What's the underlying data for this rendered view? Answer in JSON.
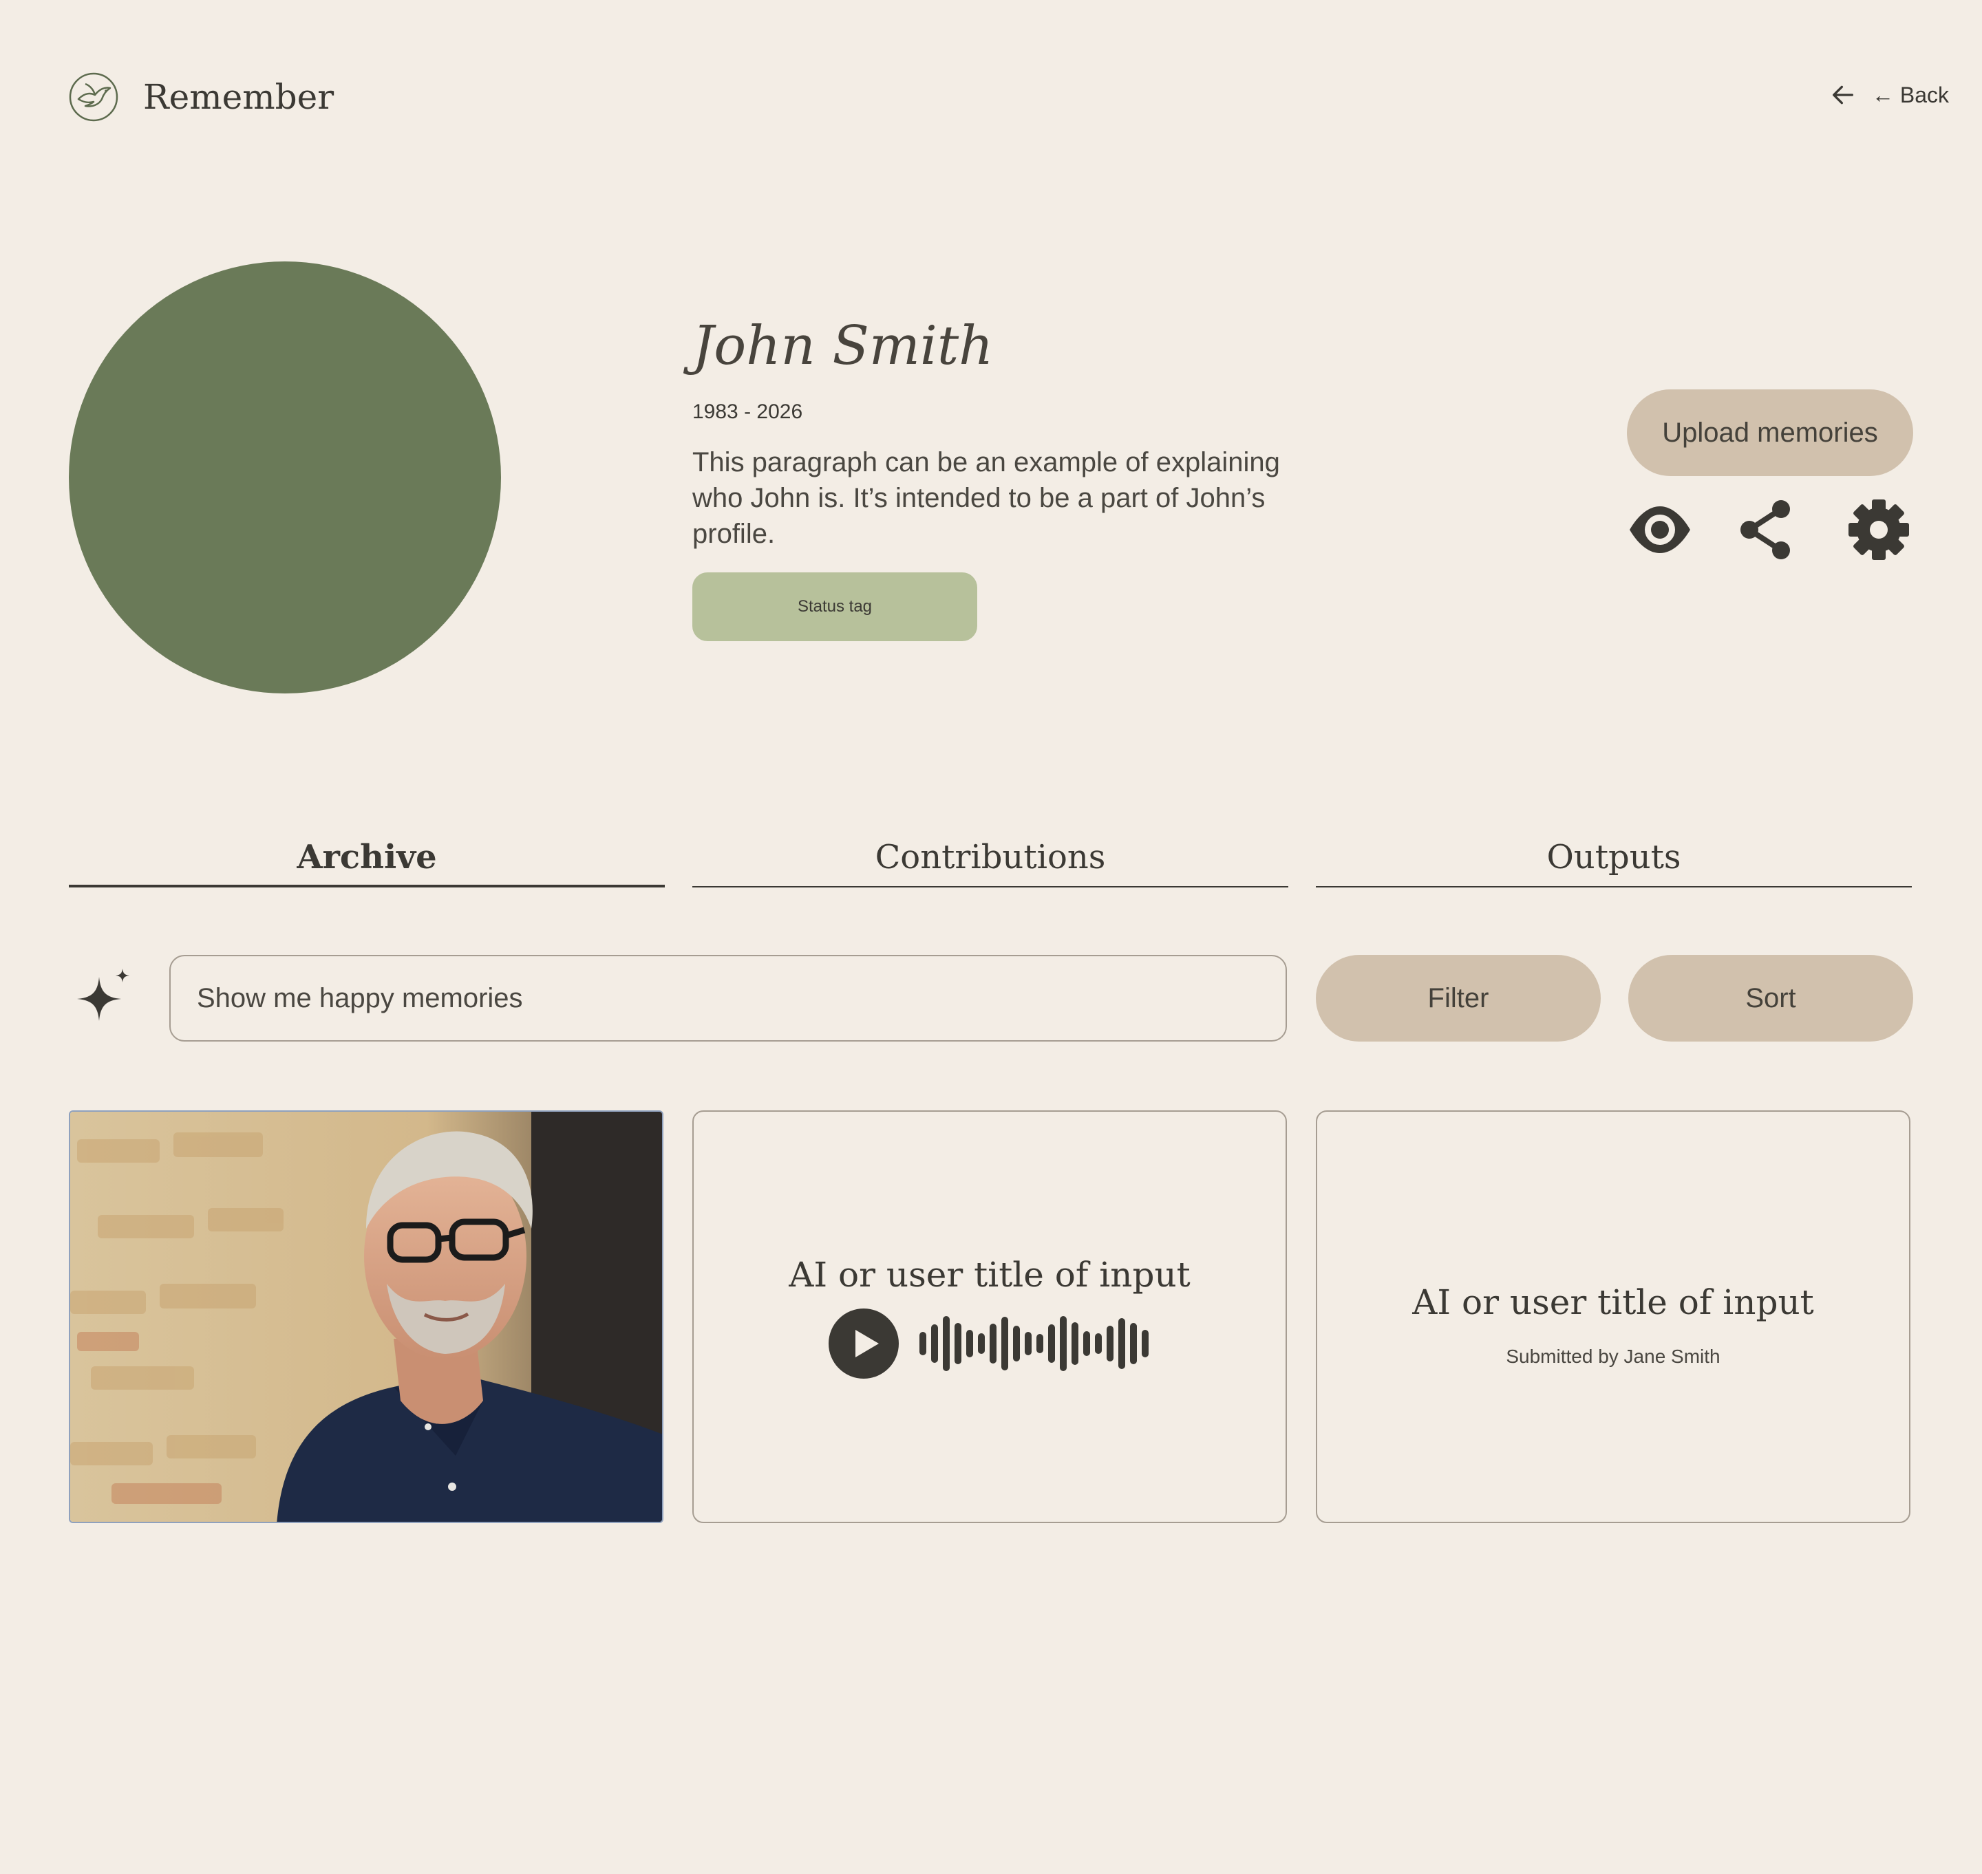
{
  "header": {
    "brand": "Remember",
    "logo_icon": "dove-icon",
    "back_label": "← Back"
  },
  "profile": {
    "name": "John Smith",
    "years": "1983 - 2026",
    "bio": "This paragraph can be an example of explaining who John is. It’s intended to be a part of John’s profile.",
    "status_tag": "Status tag",
    "avatar_color": "#6a7a58"
  },
  "actions": {
    "upload_label": "Upload memories",
    "icons": [
      "eye-icon",
      "share-icon",
      "gear-icon"
    ]
  },
  "tabs": [
    {
      "label": "Archive",
      "active": true
    },
    {
      "label": "Contributions",
      "active": false
    },
    {
      "label": "Outputs",
      "active": false
    }
  ],
  "search": {
    "value": "Show me happy memories",
    "filter_label": "Filter",
    "sort_label": "Sort"
  },
  "cards": [
    {
      "type": "photo",
      "description": "older man with glasses in navy shirt"
    },
    {
      "type": "audio",
      "title": "AI or user title of input"
    },
    {
      "type": "text",
      "title": "AI or user title of input",
      "submitted_by": "Submitted by Jane Smith"
    }
  ],
  "colors": {
    "background": "#f3ede5",
    "pill": "#d1c1ad",
    "status_tag": "#b7c19b",
    "text": "#3b3934"
  }
}
